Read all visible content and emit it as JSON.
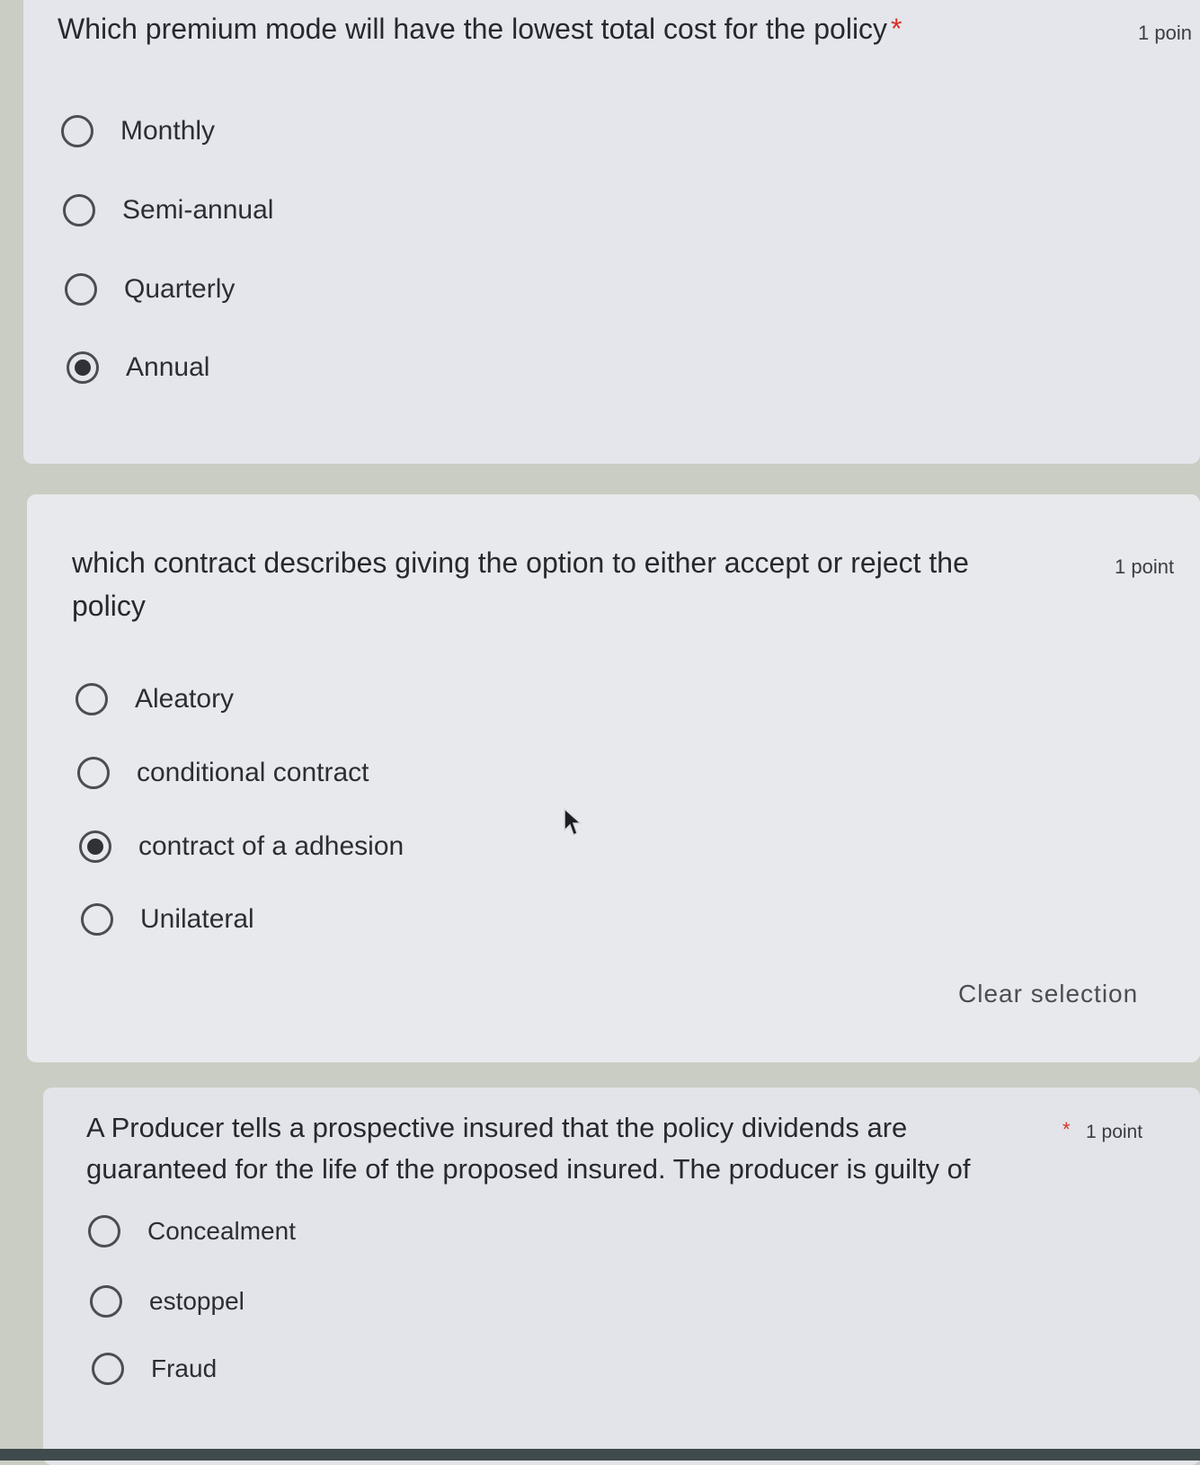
{
  "q1": {
    "title": "Which premium mode will have the lowest total cost for the policy",
    "required_mark": "*",
    "points": "1 poin",
    "options": [
      {
        "label": "Monthly",
        "selected": false
      },
      {
        "label": "Semi-annual",
        "selected": false
      },
      {
        "label": "Quarterly",
        "selected": false
      },
      {
        "label": "Annual",
        "selected": true
      }
    ]
  },
  "q2": {
    "title": "which contract describes giving the option to either accept or reject the policy",
    "points": "1 point",
    "options": [
      {
        "label": "Aleatory",
        "selected": false
      },
      {
        "label": "conditional contract",
        "selected": false
      },
      {
        "label": "contract of a adhesion",
        "selected": true
      },
      {
        "label": "Unilateral",
        "selected": false
      }
    ],
    "clear_label": "Clear selection"
  },
  "q3": {
    "title": "A Producer tells a prospective insured that the policy dividends are guaranteed for the life of the proposed insured. The producer is guilty of",
    "required_mark": "*",
    "points": "1 point",
    "options": [
      {
        "label": "Concealment",
        "selected": false
      },
      {
        "label": "estoppel",
        "selected": false
      },
      {
        "label": "Fraud",
        "selected": false
      }
    ]
  },
  "icons": {
    "cursor": "mouse-pointer-icon"
  },
  "colors": {
    "required": "#d93025",
    "card": "#e6e8ec",
    "background": "#c9cdc3"
  }
}
